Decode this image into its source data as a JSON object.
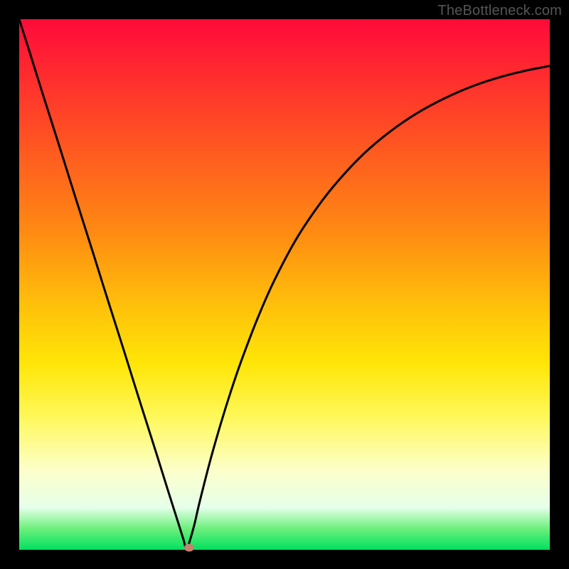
{
  "watermark": "TheBottleneck.com",
  "chart_data": {
    "type": "line",
    "title": "",
    "xlabel": "",
    "ylabel": "",
    "x": [
      0.0,
      0.02,
      0.04,
      0.06,
      0.08,
      0.1,
      0.12,
      0.14,
      0.16,
      0.18,
      0.2,
      0.22,
      0.24,
      0.26,
      0.28,
      0.3,
      0.31,
      0.315,
      0.32,
      0.33,
      0.34,
      0.36,
      0.38,
      0.4,
      0.42,
      0.45,
      0.48,
      0.52,
      0.56,
      0.6,
      0.65,
      0.7,
      0.75,
      0.8,
      0.85,
      0.9,
      0.95,
      1.0
    ],
    "values": [
      1.0,
      0.937,
      0.873,
      0.81,
      0.747,
      0.683,
      0.62,
      0.557,
      0.493,
      0.43,
      0.367,
      0.303,
      0.24,
      0.177,
      0.113,
      0.05,
      0.018,
      0.0,
      0.012,
      0.047,
      0.09,
      0.168,
      0.238,
      0.302,
      0.36,
      0.438,
      0.506,
      0.582,
      0.643,
      0.694,
      0.747,
      0.789,
      0.823,
      0.85,
      0.872,
      0.889,
      0.902,
      0.912
    ],
    "xlim": [
      0,
      1
    ],
    "ylim": [
      0,
      1
    ],
    "marker": {
      "x": 0.32,
      "y": 0.004
    },
    "stroke_color": "#000000",
    "stroke_width": 3
  },
  "colors": {
    "frame_bg": "#000000",
    "marker_fill": "#c9816f"
  }
}
